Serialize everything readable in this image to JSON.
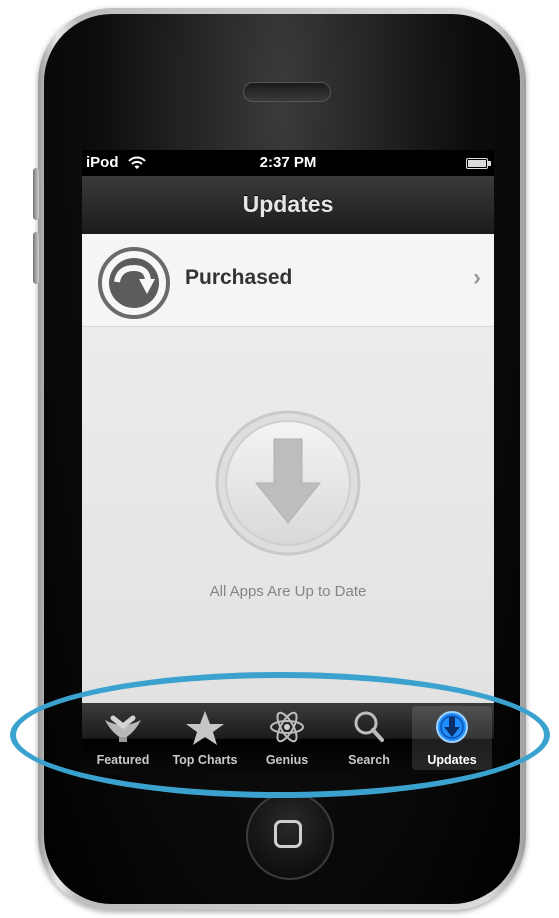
{
  "status_bar": {
    "carrier": "iPod",
    "time": "2:37 PM"
  },
  "navbar": {
    "title": "Updates"
  },
  "purchased": {
    "label": "Purchased"
  },
  "empty_state": {
    "message": "All Apps Are Up to Date"
  },
  "tabs": [
    {
      "label": "Featured",
      "icon": "featured-icon"
    },
    {
      "label": "Top Charts",
      "icon": "star-icon"
    },
    {
      "label": "Genius",
      "icon": "atom-icon"
    },
    {
      "label": "Search",
      "icon": "search-icon"
    },
    {
      "label": "Updates",
      "icon": "download-icon",
      "active": true
    }
  ],
  "colors": {
    "highlight": "#3ba2cf",
    "active_tab_icon": "#1f8fff"
  }
}
